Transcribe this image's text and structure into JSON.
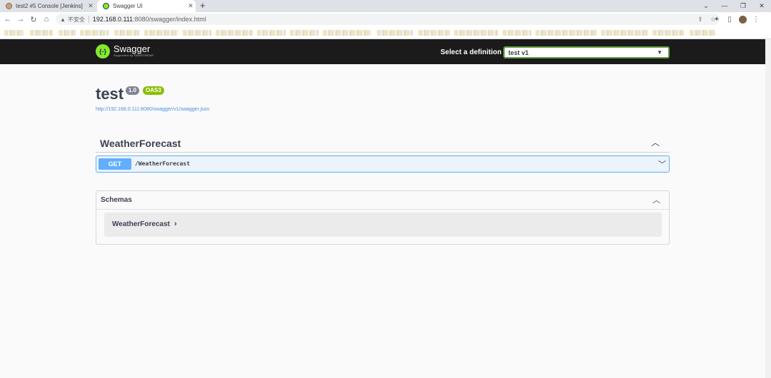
{
  "browser": {
    "tabs": [
      {
        "title": "test2 #5 Console [Jenkins]",
        "active": false
      },
      {
        "title": "Swagger UI",
        "active": true
      }
    ],
    "new_tab": "+",
    "window_controls": [
      "⌄",
      "—",
      "❐",
      "✕"
    ],
    "nav": {
      "back": "←",
      "forward": "→",
      "reload": "↻",
      "home": "⌂"
    },
    "address": {
      "security_warning": "▲",
      "security_label": "不安全",
      "host": "192.168.0.111",
      "path": ":8080/swagger/index.html"
    },
    "address_actions": [
      "⇪",
      "☆"
    ],
    "toolbar_icons": [
      "✦",
      "▯",
      "⋮"
    ]
  },
  "swagger": {
    "logo": {
      "title": "Swagger",
      "subtitle": "Supported by SMARTBEAR",
      "mark": "{-}"
    },
    "definition": {
      "label": "Select a definition",
      "selected": "test v1"
    },
    "info": {
      "title": "test",
      "version": "1.0",
      "oas": "OAS3",
      "spec_url": "http://192.168.0.111:8080/swagger/v1/swagger.json"
    },
    "tag": {
      "name": "WeatherForecast",
      "toggle": "︿"
    },
    "operation": {
      "method": "GET",
      "path": "/WeatherForecast",
      "toggle": "﹀"
    },
    "schemas": {
      "title": "Schemas",
      "toggle": "︿",
      "models": [
        {
          "name": "WeatherForecast",
          "toggle": "›"
        }
      ]
    }
  },
  "colors": {
    "get_method": "#61affe",
    "oas_badge": "#89bf04",
    "topbar": "#1b1b1b",
    "swagger_green": "#85ea2d"
  }
}
